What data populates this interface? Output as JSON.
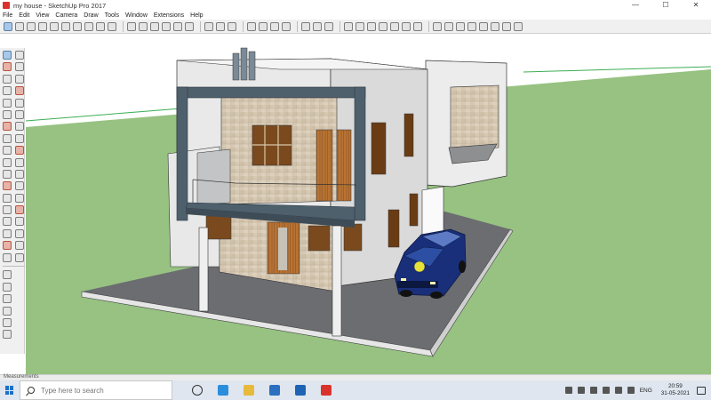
{
  "window": {
    "title": "my house - SketchUp Pro 2017",
    "controls": {
      "minimize": "—",
      "maximize": "☐",
      "close": "✕"
    }
  },
  "menu": [
    "File",
    "Edit",
    "View",
    "Camera",
    "Draw",
    "Tools",
    "Window",
    "Extensions",
    "Help"
  ],
  "toolbar": {
    "groups": [
      [
        "select-icon",
        "component-icon",
        "paint-bucket-icon",
        "eraser-icon",
        "view-iso-icon",
        "view-top-icon",
        "view-front-icon",
        "view-right-icon",
        "view-back-icon",
        "view-left-icon"
      ],
      [
        "xray-icon",
        "wireframe-icon",
        "hidden-line-icon",
        "shaded-icon",
        "textured-icon",
        "monochrome-icon"
      ],
      [
        "section-plane-icon",
        "section-display-icon",
        "section-cut-icon"
      ],
      [
        "shadows-icon",
        "fog-icon",
        "edge-style-icon",
        "profile-icon"
      ],
      [
        "layers-icon",
        "outliner-icon",
        "scenes-icon"
      ],
      [
        "sandbox-from-contours-icon",
        "sandbox-from-scratch-icon",
        "smoove-icon",
        "stamp-icon",
        "drape-icon",
        "add-detail-icon",
        "flip-edge-icon"
      ],
      [
        "warehouse-icon",
        "share-model-icon",
        "share-component-icon",
        "extension-warehouse-icon",
        "extension-manager-icon",
        "photo-texture-icon",
        "dynamic-components-icon",
        "interact-icon"
      ]
    ]
  },
  "left_toolbar": {
    "tools": [
      "select-tool-icon",
      "make-component-icon",
      "paint-bucket-tool-icon",
      "eraser-tool-icon",
      "line-tool-icon",
      "freehand-tool-icon",
      "rectangle-tool-icon",
      "rotated-rectangle-icon",
      "circle-tool-icon",
      "polygon-tool-icon",
      "arc-tool-icon",
      "two-point-arc-icon",
      "three-point-arc-icon",
      "pie-tool-icon",
      "move-tool-icon",
      "push-pull-tool-icon",
      "rotate-tool-icon",
      "follow-me-tool-icon",
      "scale-tool-icon",
      "offset-tool-icon",
      "tape-measure-tool-icon",
      "dimension-tool-icon",
      "protractor-tool-icon",
      "text-tool-icon",
      "axes-tool-icon",
      "3d-text-tool-icon",
      "orbit-tool-icon",
      "pan-tool-icon",
      "zoom-tool-icon",
      "zoom-window-icon",
      "zoom-extents-icon",
      "previous-view-icon",
      "position-camera-icon",
      "walk-tool-icon",
      "look-around-icon",
      "section-plane-tool-icon"
    ],
    "warehouse_tools": [
      "warehouse-tool-icon",
      "share-model-tool-icon",
      "home-view-icon",
      "building-icon",
      "house-icon",
      "print-icon"
    ]
  },
  "viewport": {
    "sky_color": "#ffffff",
    "ground_color": "#97c282",
    "model_name": "my house"
  },
  "measurements": {
    "label": "Measurements"
  },
  "taskbar": {
    "search_placeholder": "Type here to search",
    "apps": [
      "task-view-icon",
      "edge-icon",
      "file-explorer-icon",
      "mail-icon",
      "microsoft-store-icon",
      "sketchup-app-icon"
    ],
    "tray_language": "ENG",
    "time": "20:59",
    "date": "31-05-2021"
  },
  "colors": {
    "accent_blue": "#2a8edc",
    "sketchup_red": "#d9322b",
    "ground_green": "#97c282",
    "frame_slate": "#4f606d",
    "car_blue": "#1a2f7a"
  }
}
